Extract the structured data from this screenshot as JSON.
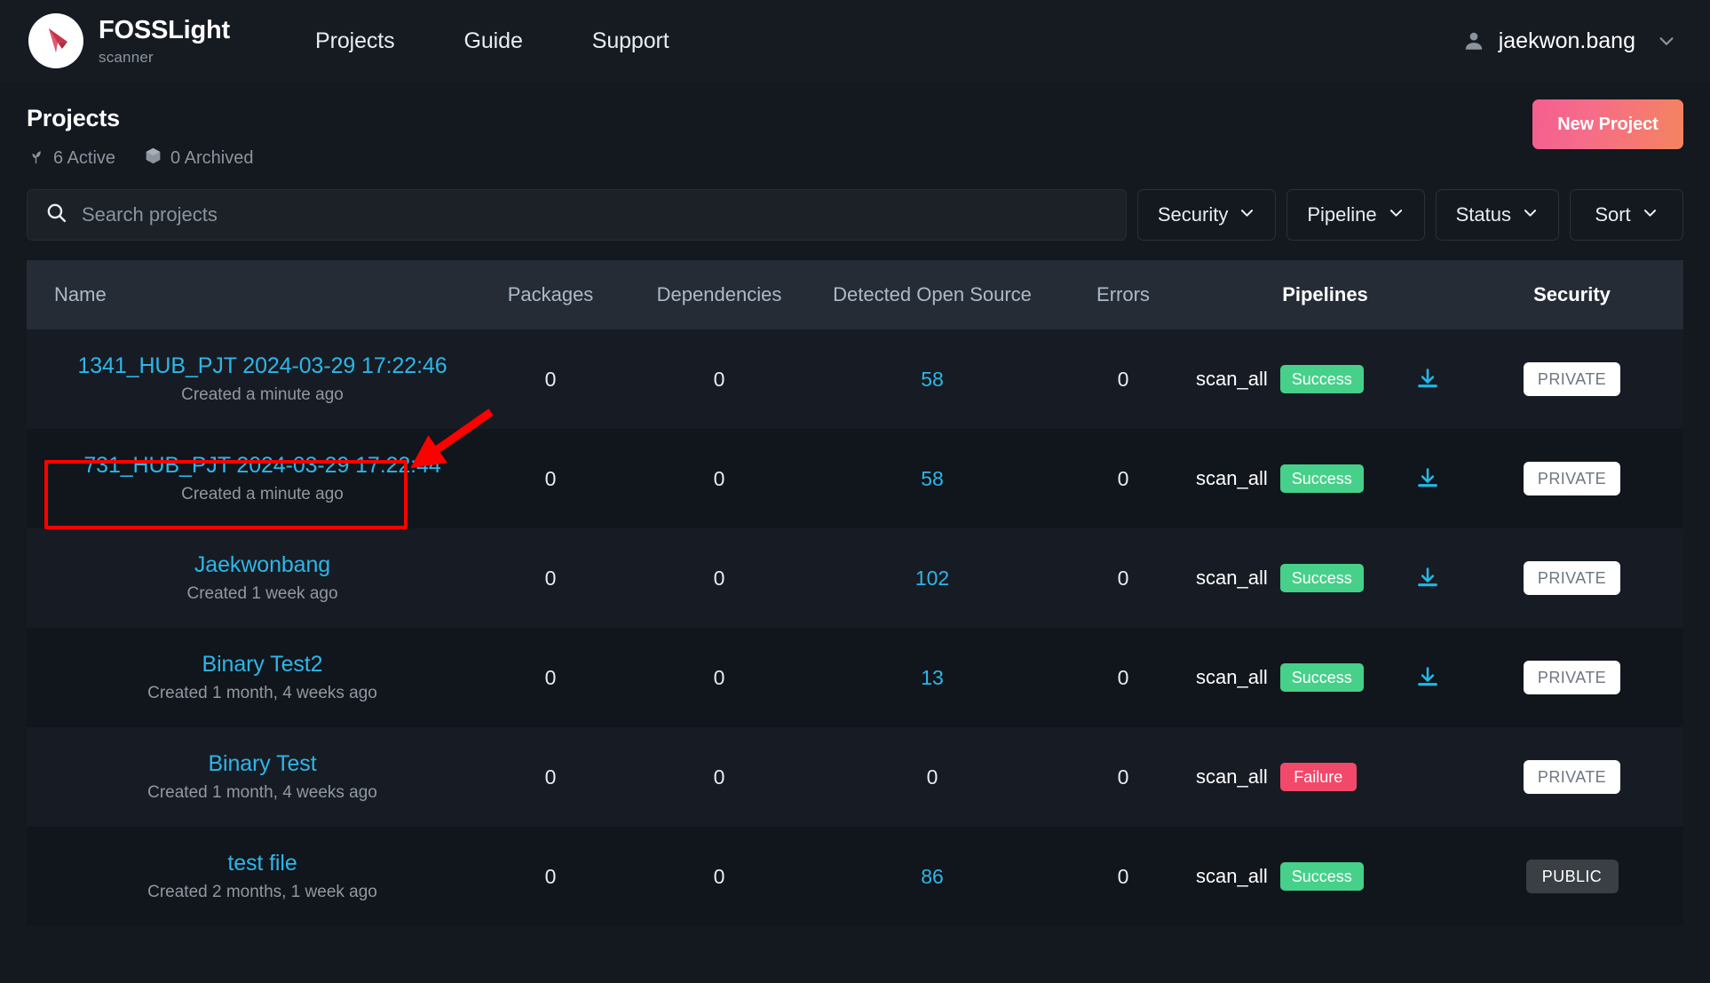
{
  "nav": {
    "brand_title": "FOSSLight",
    "brand_subtitle": "scanner",
    "logo_icon": "fosslight-cursor-logo",
    "links": [
      {
        "label": "Projects",
        "icon": ""
      },
      {
        "label": "Guide",
        "icon": ""
      },
      {
        "label": "Support",
        "icon": ""
      }
    ],
    "user": {
      "name": "jaekwon.bang",
      "avatar_icon": "person-icon",
      "chevron_icon": "chevron-down-icon"
    }
  },
  "header": {
    "title": "Projects",
    "stats": [
      {
        "icon": "sprout-icon",
        "label": "6 Active",
        "count": 6,
        "state": "Active"
      },
      {
        "icon": "box-icon",
        "label": "0 Archived",
        "count": 0,
        "state": "Archived"
      }
    ],
    "new_project_label": "New Project"
  },
  "filters": {
    "search": {
      "placeholder": "Search projects",
      "value": "",
      "icon": "search-icon"
    },
    "dropdowns": [
      {
        "label": "Security",
        "icon": "chevron-down-icon"
      },
      {
        "label": "Pipeline",
        "icon": "chevron-down-icon"
      },
      {
        "label": "Status",
        "icon": "chevron-down-icon"
      },
      {
        "label": "Sort",
        "icon": "chevron-down-icon"
      }
    ]
  },
  "table": {
    "columns": [
      "Name",
      "Packages",
      "Dependencies",
      "Detected Open Source",
      "Errors",
      "Pipelines",
      "Security"
    ],
    "rows": [
      {
        "name": "1341_HUB_PJT 2024-03-29 17:22:46",
        "created": "Created a minute ago",
        "packages": "0",
        "dependencies": "0",
        "detected_open_source": "58",
        "detected_is_link": true,
        "errors": "0",
        "pipeline_name": "scan_all",
        "pipeline_status": "Success",
        "has_download": true,
        "download_icon": "download-icon",
        "security": "PRIVATE"
      },
      {
        "name": "731_HUB_PJT 2024-03-29 17:22:44",
        "created": "Created a minute ago",
        "packages": "0",
        "dependencies": "0",
        "detected_open_source": "58",
        "detected_is_link": true,
        "errors": "0",
        "pipeline_name": "scan_all",
        "pipeline_status": "Success",
        "has_download": true,
        "download_icon": "download-icon",
        "security": "PRIVATE"
      },
      {
        "name": "Jaekwonbang",
        "created": "Created 1 week ago",
        "packages": "0",
        "dependencies": "0",
        "detected_open_source": "102",
        "detected_is_link": true,
        "errors": "0",
        "pipeline_name": "scan_all",
        "pipeline_status": "Success",
        "has_download": true,
        "download_icon": "download-icon",
        "security": "PRIVATE"
      },
      {
        "name": "Binary Test2",
        "created": "Created 1 month, 4 weeks ago",
        "packages": "0",
        "dependencies": "0",
        "detected_open_source": "13",
        "detected_is_link": true,
        "errors": "0",
        "pipeline_name": "scan_all",
        "pipeline_status": "Success",
        "has_download": true,
        "download_icon": "download-icon",
        "security": "PRIVATE"
      },
      {
        "name": "Binary Test",
        "created": "Created 1 month, 4 weeks ago",
        "packages": "0",
        "dependencies": "0",
        "detected_open_source": "0",
        "detected_is_link": false,
        "errors": "0",
        "pipeline_name": "scan_all",
        "pipeline_status": "Failure",
        "has_download": false,
        "download_icon": "",
        "security": "PRIVATE"
      },
      {
        "name": "test file",
        "created": "Created 2 months, 1 week ago",
        "packages": "0",
        "dependencies": "0",
        "detected_open_source": "86",
        "detected_is_link": true,
        "errors": "0",
        "pipeline_name": "scan_all",
        "pipeline_status": "Success",
        "has_download": false,
        "download_icon": "",
        "security": "PUBLIC"
      }
    ]
  },
  "annotations": {
    "highlight_box_color": "#fe0000",
    "arrow_color": "#fe0000",
    "target_row_index": 1
  },
  "colors": {
    "page_bg": "#14181f",
    "nav_bg": "#161b22",
    "table_head_bg": "#262c36",
    "link": "#2eb6e8",
    "success": "#46d08a",
    "failure": "#f2496a",
    "muted": "#8b949e",
    "accent_gradient_from": "#f55f8f",
    "accent_gradient_to": "#f4845f"
  }
}
